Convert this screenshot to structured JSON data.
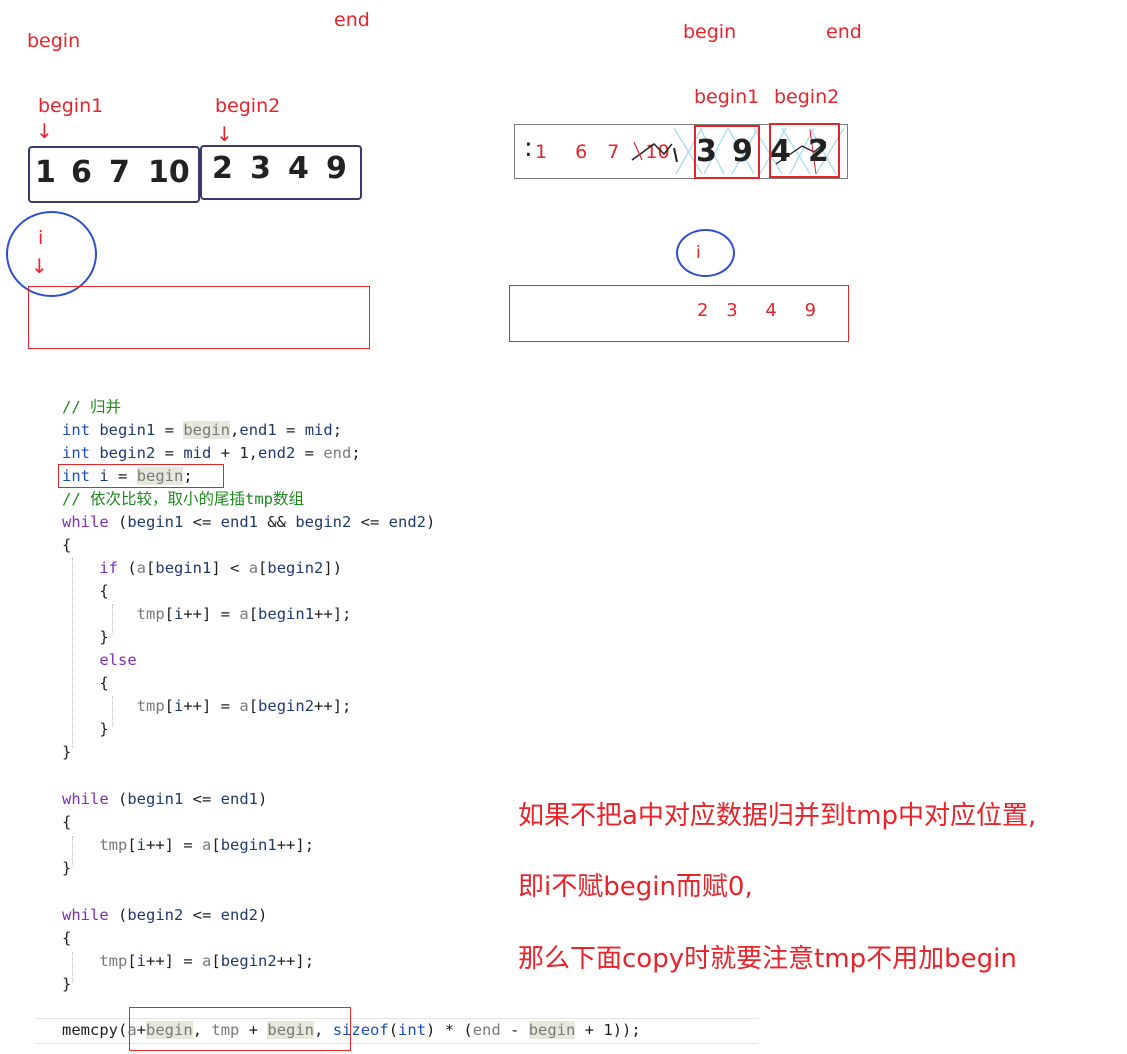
{
  "left_diagram": {
    "begin_label": "begin",
    "end_label": "end",
    "begin1_label": "begin1",
    "begin2_label": "begin2",
    "left_values": [
      "1",
      "6",
      "7",
      "10"
    ],
    "right_values": [
      "2",
      "3",
      "4",
      "9"
    ],
    "i_label": "i"
  },
  "right_diagram": {
    "begin_label": "begin",
    "end_label": "end",
    "begin1_label": "begin1",
    "begin2_label": "begin2",
    "faded_values": [
      "1",
      "6",
      "7",
      "10"
    ],
    "bold_values": [
      "3",
      "9",
      "4",
      "2"
    ],
    "i_label": "i",
    "tmp_values": [
      "2",
      "3",
      "4",
      "9"
    ]
  },
  "code": {
    "comment_merge": "// 归并",
    "comment_loop": "// 依次比较，取小的尾插tmp数组"
  },
  "notes": [
    "如果不把a中对应数据归并到tmp中对应位置,",
    "即i不赋begin而赋0,",
    "那么下面copy时就要注意tmp不用加begin"
  ],
  "colors": {
    "annotation": "#e8232a",
    "circle": "#2f4fcf",
    "box_border": "#3a3a6a"
  }
}
